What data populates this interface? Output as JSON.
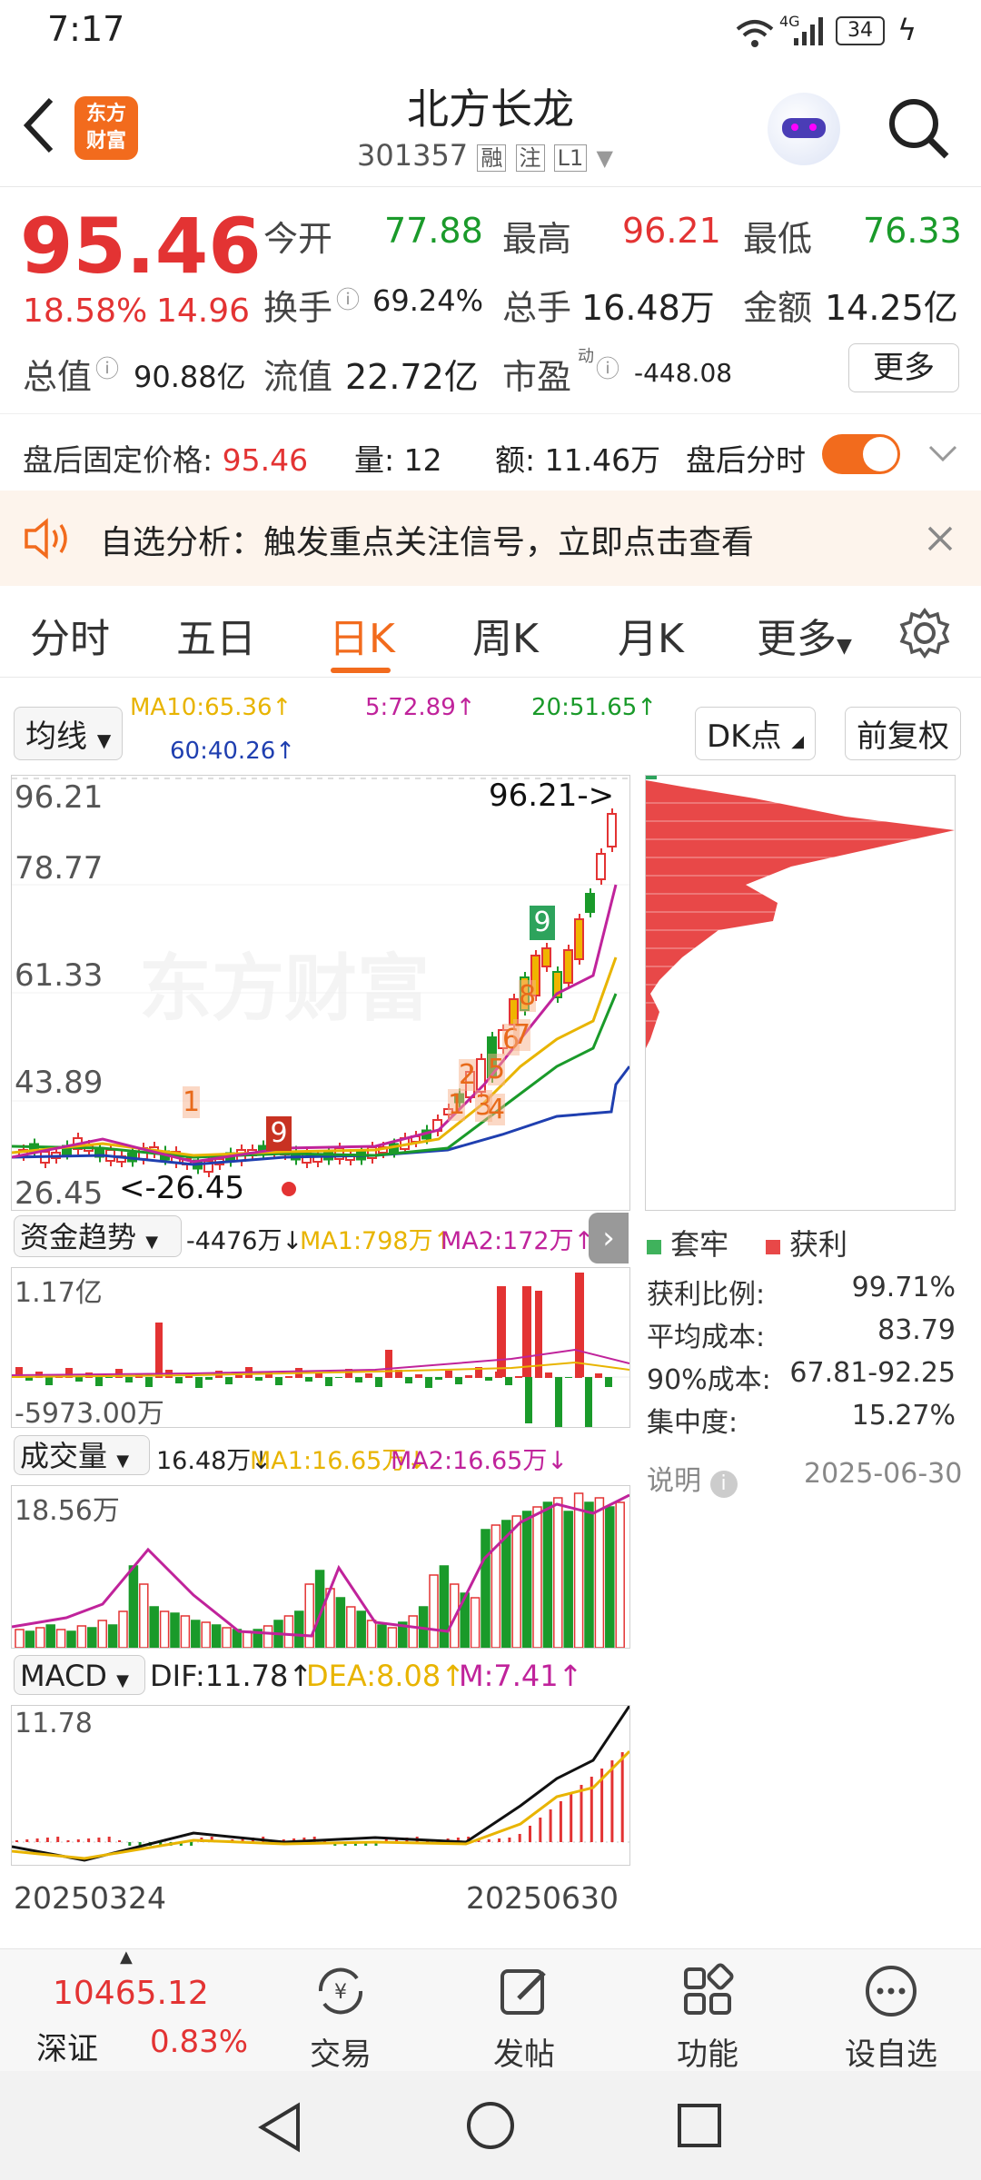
{
  "status": {
    "time": "7:17",
    "battery": "34",
    "signal_label": "4G"
  },
  "header": {
    "title": "北方长龙",
    "code": "301357",
    "badges": [
      "融",
      "注",
      "L1"
    ],
    "logo_lines": [
      "东方",
      "财富"
    ]
  },
  "quote": {
    "price": "95.46",
    "pct": "18.58%",
    "change": "14.96",
    "open_label": "今开",
    "open": "77.88",
    "high_label": "最高",
    "high": "96.21",
    "low_label": "最低",
    "low": "76.33",
    "turnover_label": "换手",
    "turnover": "69.24%",
    "volume_label": "总手",
    "volume": "16.48万",
    "amount_label": "金额",
    "amount": "14.25亿",
    "mktcap_label": "总值",
    "mktcap": "90.88亿",
    "float_label": "流值",
    "float": "22.72亿",
    "pe_label": "市盈",
    "pe_super": "动",
    "pe": "-448.08",
    "more_label": "更多"
  },
  "afterhours": {
    "label": "盘后固定价格:",
    "price": "95.46",
    "qty_label": "量:",
    "qty": "12",
    "amt_label": "额:",
    "amt": "11.46万",
    "toggle_label": "盘后分时",
    "toggle_on": true
  },
  "banner": {
    "text": "自选分析：触发重点关注信号，立即点击查看"
  },
  "tabs": [
    "分时",
    "五日",
    "日K",
    "周K",
    "月K",
    "更多"
  ],
  "active_tab": "日K",
  "ma_bar": {
    "selector": "均线",
    "ma10": "MA10:65.36↑",
    "ma5": "5:72.89↑",
    "ma20": "20:51.65↑",
    "ma60": "60:40.26↑",
    "dk_label": "DK点",
    "fq_label": "前复权"
  },
  "kchart": {
    "y_ticks": [
      "96.21",
      "78.77",
      "61.33",
      "43.89",
      "26.45"
    ],
    "high_marker": "96.21->",
    "low_marker": "<-26.45",
    "watermark": "东方财富",
    "counter_labels": [
      "1",
      "2",
      "3",
      "4",
      "5",
      "6",
      "7",
      "8",
      "9"
    ]
  },
  "capital": {
    "selector": "资金趋势",
    "value": "-4476万↓",
    "ma1": "MA1:798万↑",
    "ma2": "MA2:172万↑",
    "top": "1.17亿",
    "bottom": "-5973.00万"
  },
  "volume": {
    "selector": "成交量",
    "value": "16.48万↓",
    "ma1": "MA1:16.65万↓",
    "ma2": "MA2:16.65万↓",
    "top": "18.56万"
  },
  "macd": {
    "selector": "MACD",
    "dif": "DIF:11.78↑",
    "dea": "DEA:8.08↑",
    "m": "M:7.41↑",
    "top": "11.78"
  },
  "dates": {
    "start": "20250324",
    "end": "20250630"
  },
  "chips": {
    "legend_trap": "套牢",
    "legend_profit": "获利",
    "rows": [
      {
        "label": "获利比例:",
        "value": "99.71%"
      },
      {
        "label": "平均成本:",
        "value": "83.79"
      },
      {
        "label": "90%成本:",
        "value": "67.81-92.25"
      },
      {
        "label": "集中度:",
        "value": "15.27%"
      }
    ],
    "note_label": "说明",
    "date": "2025-06-30"
  },
  "bottom": {
    "index_value": "10465.12",
    "index_name": "深证",
    "index_pct": "0.83%",
    "items": [
      "交易",
      "发帖",
      "功能",
      "设自选"
    ]
  },
  "colors": {
    "up": "#e33333",
    "down": "#1a9a2a",
    "accent": "#f26b1d",
    "ma5": "#c0239b",
    "ma10": "#e8b400",
    "ma20": "#1a9a2a",
    "ma60": "#1f3fb0"
  }
}
